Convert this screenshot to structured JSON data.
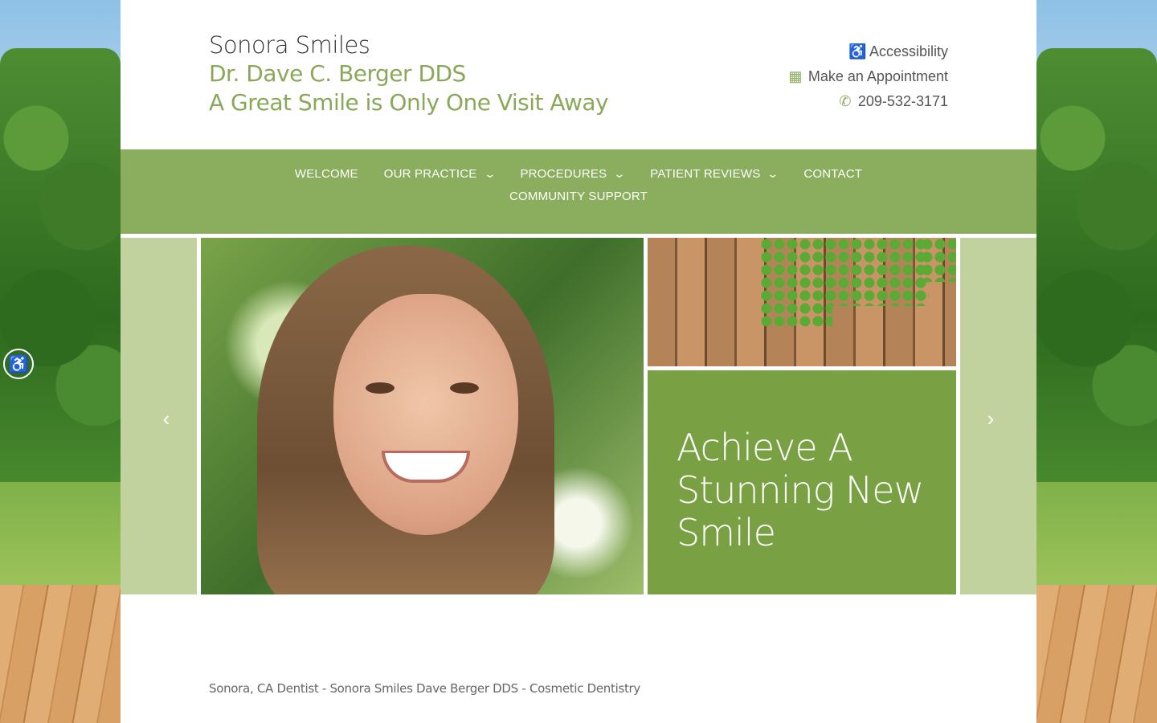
{
  "header": {
    "name": "Sonora Smiles",
    "doctor": "Dr. Dave C. Berger DDS",
    "tagline": "A Great Smile is Only One Visit Away"
  },
  "utility": {
    "accessibility": "Accessibility",
    "appointment": "Make an Appointment",
    "phone": "209-532-3171"
  },
  "nav": {
    "items": [
      {
        "label": "WELCOME"
      },
      {
        "label": "OUR PRACTICE"
      },
      {
        "label": "PROCEDURES"
      },
      {
        "label": "PATIENT REVIEWS"
      },
      {
        "label": "CONTACT"
      },
      {
        "label": "COMMUNITY SUPPORT"
      }
    ]
  },
  "slider": {
    "headline": "Achieve A Stunning New Smile",
    "prev": "‹",
    "next": "›"
  },
  "footer": {
    "text": "Sonora, CA Dentist - Sonora Smiles Dave Berger DDS - Cosmetic Dentistry"
  },
  "colors": {
    "brand_green": "#8aae5e",
    "card_green": "#79a043",
    "side_green": "#c2d29e",
    "accent_text": "#8aa85a"
  },
  "icons": {
    "accessibility": "wheelchair-icon",
    "appointment": "calendar-icon",
    "phone": "phone-icon",
    "dropdown": "chevron-down-icon",
    "prev": "chevron-left-icon",
    "next": "chevron-right-icon",
    "a11y_widget": "accessibility-person-icon"
  }
}
